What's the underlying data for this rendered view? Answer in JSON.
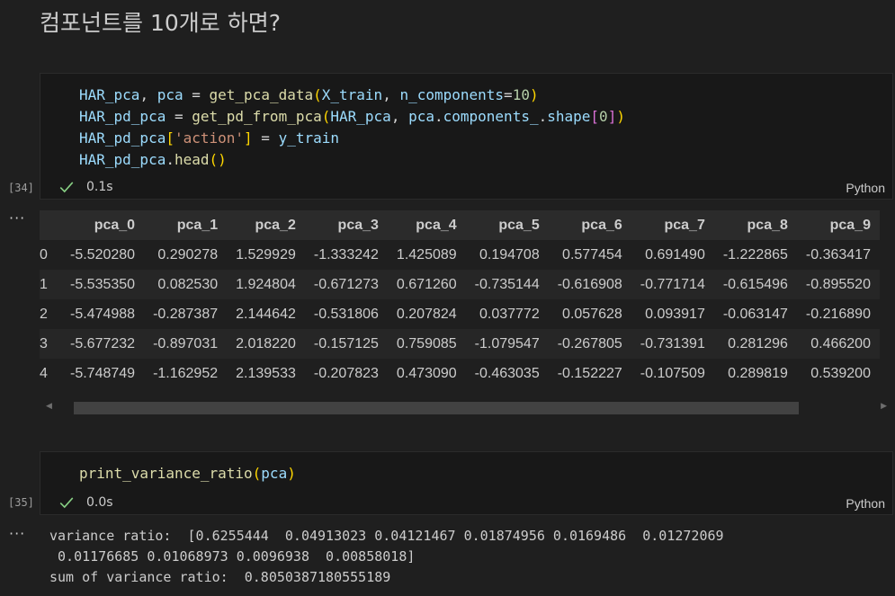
{
  "markdown": {
    "heading": "컴포넌트를 10개로 하면?"
  },
  "cell1": {
    "exec_count": "[34]",
    "status_time": "0.1s",
    "language": "Python",
    "lines": [
      [
        [
          "t-var",
          "HAR_pca"
        ],
        [
          "t-op",
          ", "
        ],
        [
          "t-var",
          "pca"
        ],
        [
          "t-op",
          " = "
        ],
        [
          "t-fn",
          "get_pca_data"
        ],
        [
          "t-b1",
          "("
        ],
        [
          "t-var",
          "X_train"
        ],
        [
          "t-op",
          ", "
        ],
        [
          "t-var",
          "n_components"
        ],
        [
          "t-op",
          "="
        ],
        [
          "t-num",
          "10"
        ],
        [
          "t-b1",
          ")"
        ]
      ],
      [
        [
          "t-var",
          "HAR_pd_pca"
        ],
        [
          "t-op",
          " = "
        ],
        [
          "t-fn",
          "get_pd_from_pca"
        ],
        [
          "t-b1",
          "("
        ],
        [
          "t-var",
          "HAR_pca"
        ],
        [
          "t-op",
          ", "
        ],
        [
          "t-var",
          "pca"
        ],
        [
          "t-op",
          "."
        ],
        [
          "t-var",
          "components_"
        ],
        [
          "t-op",
          "."
        ],
        [
          "t-var",
          "shape"
        ],
        [
          "t-b2",
          "["
        ],
        [
          "t-num",
          "0"
        ],
        [
          "t-b2",
          "]"
        ],
        [
          "t-b1",
          ")"
        ]
      ],
      [
        [
          "t-var",
          "HAR_pd_pca"
        ],
        [
          "t-b1",
          "["
        ],
        [
          "t-str",
          "'action'"
        ],
        [
          "t-b1",
          "]"
        ],
        [
          "t-op",
          " = "
        ],
        [
          "t-var",
          "y_train"
        ]
      ],
      [
        [
          "t-var",
          "HAR_pd_pca"
        ],
        [
          "t-op",
          "."
        ],
        [
          "t-fn",
          "head"
        ],
        [
          "t-b1",
          "()"
        ]
      ]
    ]
  },
  "dataframe": {
    "columns": [
      "pca_0",
      "pca_1",
      "pca_2",
      "pca_3",
      "pca_4",
      "pca_5",
      "pca_6",
      "pca_7",
      "pca_8",
      "pca_9"
    ],
    "rows": [
      {
        "index": "0",
        "values": [
          "-5.520280",
          "0.290278",
          "1.529929",
          "-1.333242",
          "1.425089",
          "0.194708",
          "0.577454",
          "0.691490",
          "-1.222865",
          "-0.363417"
        ]
      },
      {
        "index": "1",
        "values": [
          "-5.535350",
          "0.082530",
          "1.924804",
          "-0.671273",
          "0.671260",
          "-0.735144",
          "-0.616908",
          "-0.771714",
          "-0.615496",
          "-0.895520"
        ]
      },
      {
        "index": "2",
        "values": [
          "-5.474988",
          "-0.287387",
          "2.144642",
          "-0.531806",
          "0.207824",
          "0.037772",
          "0.057628",
          "0.093917",
          "-0.063147",
          "-0.216890"
        ]
      },
      {
        "index": "3",
        "values": [
          "-5.677232",
          "-0.897031",
          "2.018220",
          "-0.157125",
          "0.759085",
          "-1.079547",
          "-0.267805",
          "-0.731391",
          "0.281296",
          "0.466200"
        ]
      },
      {
        "index": "4",
        "values": [
          "-5.748749",
          "-1.162952",
          "2.139533",
          "-0.207823",
          "0.473090",
          "-0.463035",
          "-0.152227",
          "-0.107509",
          "0.289819",
          "0.539200"
        ]
      }
    ]
  },
  "cell2": {
    "exec_count": "[35]",
    "status_time": "0.0s",
    "language": "Python",
    "lines": [
      [
        [
          "t-fn",
          "print_variance_ratio"
        ],
        [
          "t-b1",
          "("
        ],
        [
          "t-var",
          "pca"
        ],
        [
          "t-b1",
          ")"
        ]
      ]
    ]
  },
  "output2": {
    "lines": [
      "variance ratio:  [0.6255444  0.04913023 0.04121467 0.01874956 0.0169486  0.01272069",
      " 0.01176685 0.01068973 0.0096938  0.00858018]",
      "sum of variance ratio:  0.8050387180555189"
    ]
  },
  "output_marker": "···",
  "colors": {
    "background": "#1f1f1f",
    "cell_bg": "#181818",
    "check_green": "#89d185"
  }
}
